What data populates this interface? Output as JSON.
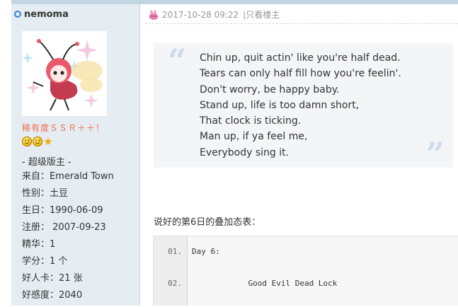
{
  "user": {
    "username": "nemoma",
    "rank_title": "稀有度ＳＳＲ＋＋！",
    "role": "- 超级版主 -",
    "info": [
      {
        "label": "来自：",
        "value": "Emerald Town"
      },
      {
        "label": "性别：",
        "value": "土豆"
      },
      {
        "label": "生日：",
        "value": "1990-06-09"
      },
      {
        "label": "注册：",
        "value": " 2007-09-23"
      },
      {
        "label": "精华：",
        "value": "1"
      },
      {
        "label": "学分：",
        "value": "1 个"
      },
      {
        "label": "好人卡：",
        "value": "21 张"
      },
      {
        "label": "好感度：",
        "value": "2040"
      }
    ],
    "medals": [
      "smiley-medal-icon",
      "smiley-medal-icon",
      "star-medal-icon"
    ]
  },
  "post": {
    "timestamp": "2017-10-28 09:22",
    "separator": "|",
    "only_author": "只看楼主",
    "quote_lines": [
      "Chin up, quit actin' like you're half dead.",
      "Tears can only half fill how you're feelin'.",
      "Don't worry, be happy baby.",
      "Stand up, life is too damn short,",
      "That clock is ticking.",
      "Man up, if ya feel me,",
      "Everybody sing it."
    ],
    "intro_text": "说好的第6日的叠加态表：",
    "code_lines": [
      {
        "num": "01.",
        "text": "Day 6:"
      },
      {
        "num": "02.",
        "text": "            Good Evil Dead Lock"
      }
    ]
  },
  "colors": {
    "sidebar_bg": "#e5edf2",
    "accent_blue": "#3a7bd5",
    "rank_orange": "#f26c4f",
    "quote_mark": "#cddceb"
  }
}
